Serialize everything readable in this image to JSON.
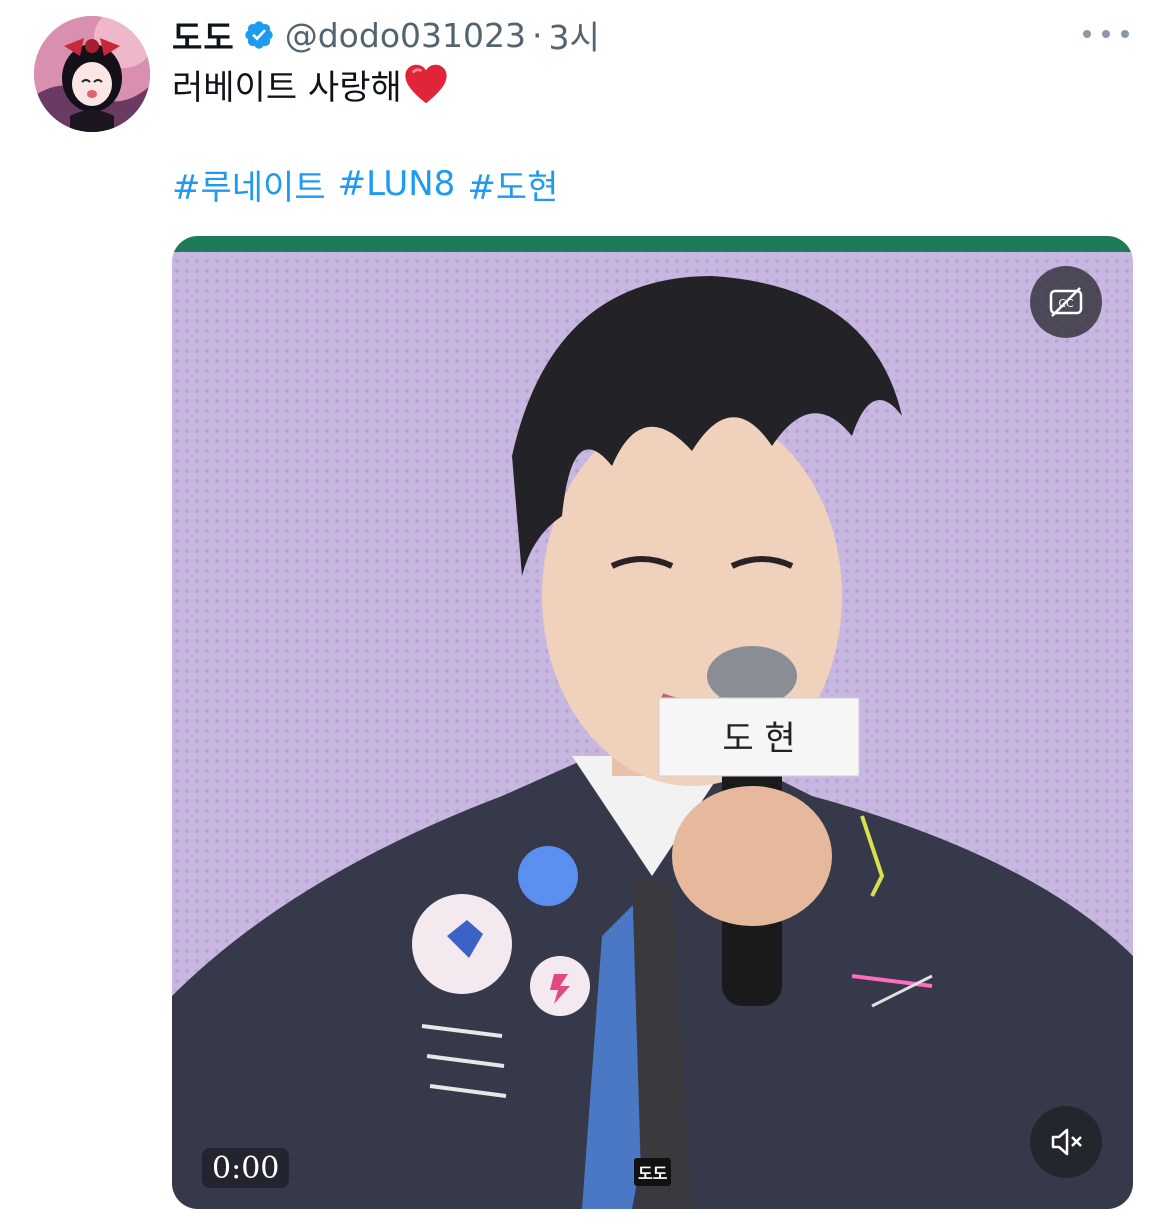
{
  "tweet": {
    "display_name": "도도",
    "handle": "@dodo031023",
    "separator": "·",
    "time": "3시",
    "text": "러베이트 사랑해",
    "hashtags": [
      "#루네이트",
      "#LUN8",
      "#도현"
    ]
  },
  "video": {
    "timestamp": "0:00",
    "name_card": "도  현",
    "watermark": "도도"
  },
  "icons": {
    "verified": "verified-badge-icon",
    "more": "more-options-icon",
    "captions": "captions-off-icon",
    "mute": "volume-muted-icon",
    "heart": "red-heart-emoji"
  },
  "colors": {
    "link": "#1d9bf0",
    "verified": "#1d9bf0",
    "secondary_text": "#536471"
  }
}
